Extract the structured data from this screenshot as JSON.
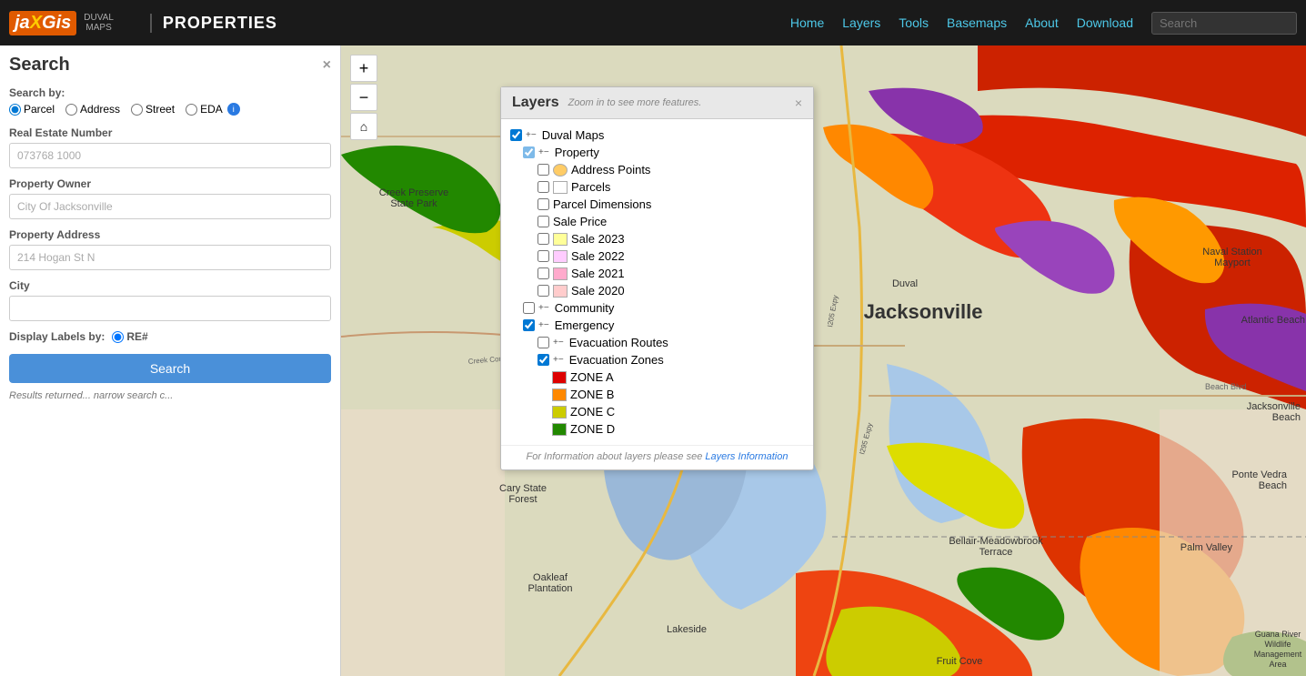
{
  "app": {
    "logo_text": "jaXGis",
    "logo_highlight": "X",
    "logo_sub1": "DUVAL",
    "logo_sub2": "MAPS",
    "title": "PROPERTIES"
  },
  "nav": {
    "home": "Home",
    "layers": "Layers",
    "tools": "Tools",
    "basemaps": "Basemaps",
    "about": "About",
    "download": "Download",
    "search_placeholder": "Search"
  },
  "search_panel": {
    "title": "Search",
    "close": "×",
    "search_by_label": "Search by:",
    "radio_options": [
      "Parcel",
      "Address",
      "Street",
      "EDA"
    ],
    "re_number_label": "Real Estate Number",
    "re_number_placeholder": "073768 1000",
    "owner_label": "Property Owner",
    "owner_placeholder": "City Of Jacksonville",
    "address_label": "Property Address",
    "address_placeholder": "214 Hogan St N",
    "city_label": "City",
    "city_placeholder": "",
    "display_labels_label": "Display Labels by:",
    "display_labels_option": "RE#",
    "search_button": "Search",
    "results_text": "Results returned... narrow search c..."
  },
  "layers_panel": {
    "title": "Layers",
    "subtitle": "Zoom in to see more features.",
    "close": "×",
    "items": [
      {
        "id": "duval-maps",
        "label": "Duval Maps",
        "indent": 0,
        "checked": true,
        "partial": true,
        "expand": "+-"
      },
      {
        "id": "property",
        "label": "Property",
        "indent": 1,
        "checked": true,
        "partial": true,
        "expand": "+-"
      },
      {
        "id": "address-points",
        "label": "Address Points",
        "indent": 2,
        "checked": false,
        "swatch": "#ffcc66",
        "expand": ""
      },
      {
        "id": "parcels",
        "label": "Parcels",
        "indent": 2,
        "checked": false,
        "swatch": "",
        "expand": ""
      },
      {
        "id": "parcel-dimensions",
        "label": "Parcel Dimensions",
        "indent": 2,
        "checked": false,
        "swatch": "",
        "expand": ""
      },
      {
        "id": "sale-price",
        "label": "Sale Price",
        "indent": 2,
        "checked": false,
        "swatch": "",
        "expand": ""
      },
      {
        "id": "sale-2023",
        "label": "Sale 2023",
        "indent": 2,
        "checked": false,
        "swatch": "#ffff99",
        "expand": ""
      },
      {
        "id": "sale-2022",
        "label": "Sale 2022",
        "indent": 2,
        "checked": false,
        "swatch": "#ffccff",
        "expand": ""
      },
      {
        "id": "sale-2021",
        "label": "Sale 2021",
        "indent": 2,
        "checked": false,
        "swatch": "#ffaacc",
        "expand": ""
      },
      {
        "id": "sale-2020",
        "label": "Sale 2020",
        "indent": 2,
        "checked": false,
        "swatch": "#ffcccc",
        "expand": ""
      },
      {
        "id": "community",
        "label": "Community",
        "indent": 1,
        "checked": false,
        "partial": false,
        "expand": "+-"
      },
      {
        "id": "emergency",
        "label": "Emergency",
        "indent": 1,
        "checked": true,
        "partial": false,
        "expand": "+-"
      },
      {
        "id": "evacuation-routes",
        "label": "Evacuation Routes",
        "indent": 2,
        "checked": false,
        "expand": "+-"
      },
      {
        "id": "evacuation-zones",
        "label": "Evacuation Zones",
        "indent": 2,
        "checked": true,
        "expand": "+-"
      },
      {
        "id": "zone-a",
        "label": "ZONE A",
        "indent": 3,
        "checked": false,
        "swatch": "#dd0000",
        "expand": ""
      },
      {
        "id": "zone-b",
        "label": "ZONE B",
        "indent": 3,
        "checked": false,
        "swatch": "#ff8800",
        "expand": ""
      },
      {
        "id": "zone-c",
        "label": "ZONE C",
        "indent": 3,
        "checked": false,
        "swatch": "#cccc00",
        "expand": ""
      },
      {
        "id": "zone-d",
        "label": "ZONE D",
        "indent": 3,
        "checked": false,
        "swatch": "#228800",
        "expand": ""
      }
    ],
    "footer_text": "For Information about layers please see ",
    "footer_link": "Layers Information"
  },
  "map": {
    "zoom_in": "+",
    "zoom_out": "−",
    "home_icon": "⌂"
  },
  "colors": {
    "nav_bg": "#1a1a1a",
    "logo_orange": "#e05a00",
    "link_blue": "#4dc8e8",
    "search_btn": "#4a90d9"
  }
}
